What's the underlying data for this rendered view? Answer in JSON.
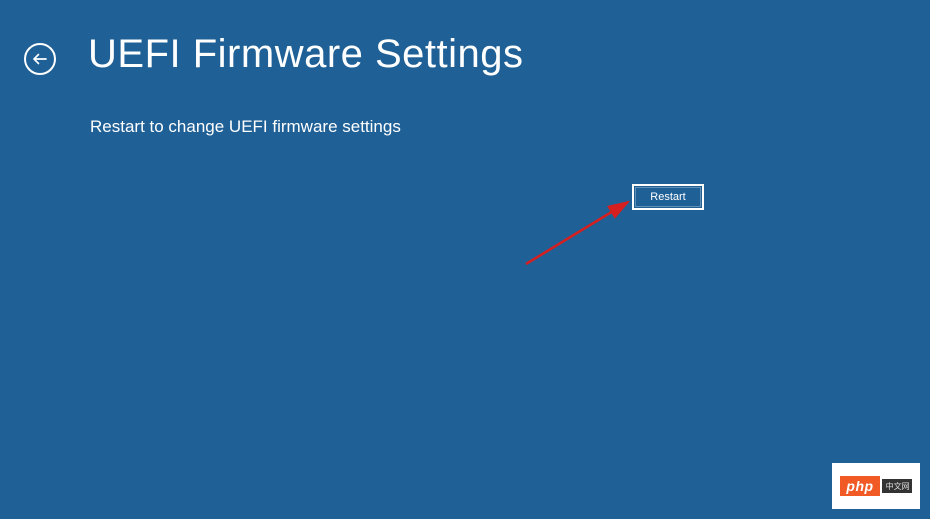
{
  "header": {
    "title": "UEFI Firmware Settings"
  },
  "content": {
    "description": "Restart to change UEFI firmware settings"
  },
  "actions": {
    "restart_label": "Restart"
  },
  "watermark": {
    "text": "php",
    "suffix": "中文网"
  }
}
